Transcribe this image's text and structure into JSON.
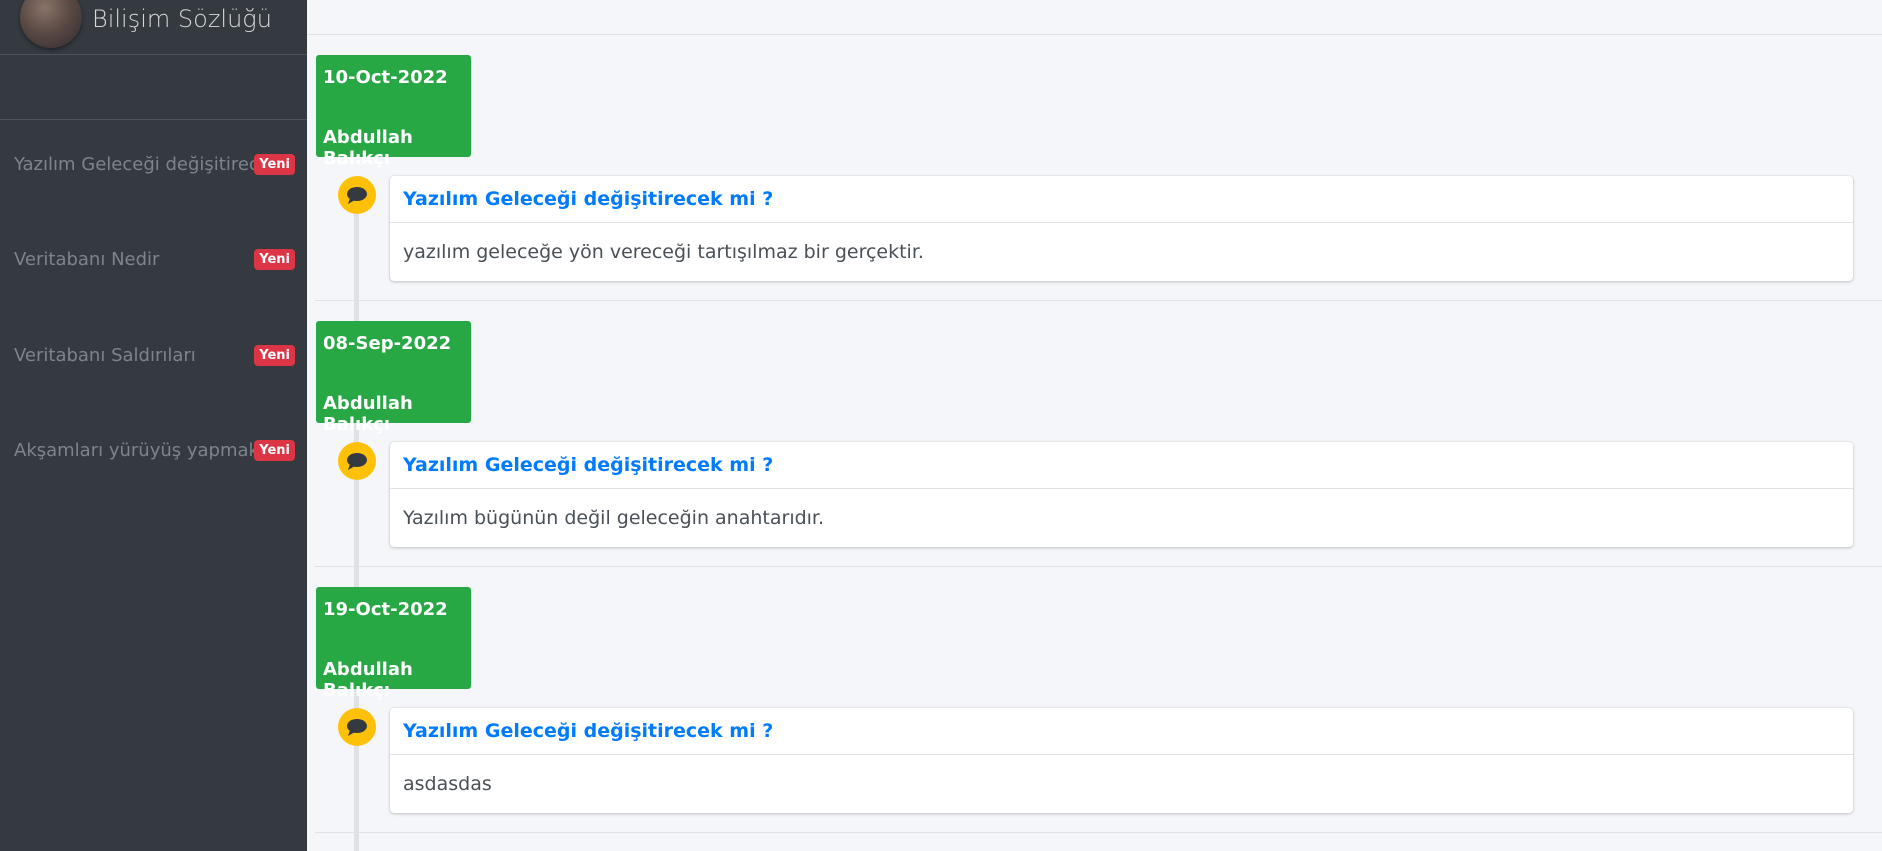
{
  "brand": {
    "title": "Bilişim Sözlüğü"
  },
  "sidebar": {
    "items": [
      {
        "label": "Yazılım Geleceği değişitirecek mi ?",
        "badge": "Yeni"
      },
      {
        "label": "Veritabanı Nedir",
        "badge": "Yeni"
      },
      {
        "label": "Veritabanı Saldırıları",
        "badge": "Yeni"
      },
      {
        "label": "Akşamları yürüyüş yapmak",
        "badge": "Yeni"
      }
    ]
  },
  "timeline": [
    {
      "date": "10-Oct-2022",
      "author": "Abdullah Balıkçı",
      "title": "Yazılım Geleceği değişitirecek mi ?",
      "body": "yazılım geleceğe yön vereceği tartışılmaz bir gerçektir."
    },
    {
      "date": "08-Sep-2022",
      "author": "Abdullah Balıkçı",
      "title": "Yazılım Geleceği değişitirecek mi ?",
      "body": "Yazılım bügünün değil geleceğin anahtarıdır."
    },
    {
      "date": "19-Oct-2022",
      "author": "Abdullah Balıkçı",
      "title": "Yazılım Geleceği değişitirecek mi ?",
      "body": "asdasdas"
    }
  ],
  "colors": {
    "sidebar": "#343a40",
    "date_bg": "#28a745",
    "icon_bg": "#ffc107",
    "title": "#007bff",
    "badge": "#dc3545"
  },
  "icons": {
    "entry": "comment-icon"
  }
}
